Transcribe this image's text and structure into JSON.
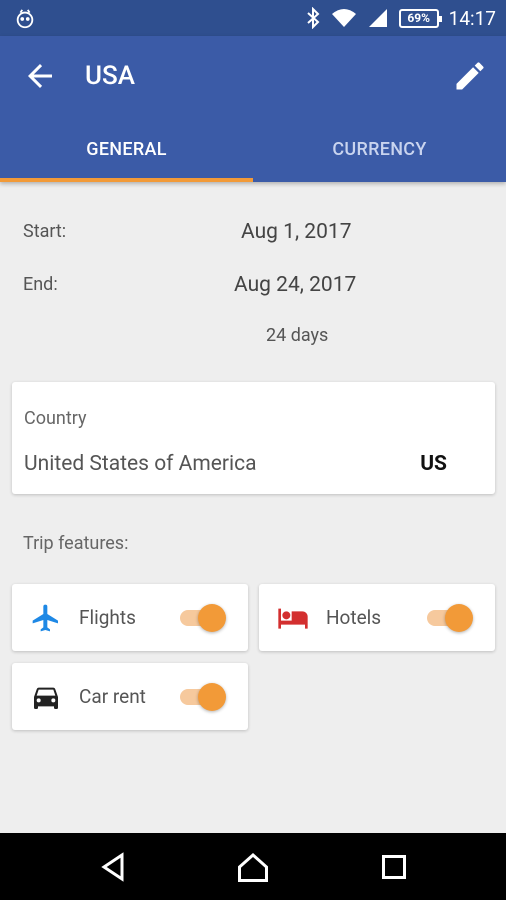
{
  "status_bar": {
    "time": "14:17",
    "battery": "69%",
    "icons": [
      "app-notification-icon",
      "bluetooth-icon",
      "wifi-icon",
      "signal-icon",
      "battery-icon"
    ]
  },
  "app_bar": {
    "title": "USA",
    "back_icon": "arrow-back-icon",
    "edit_icon": "pencil-icon",
    "color": "#3b5ba7"
  },
  "tabs": [
    {
      "label": "GENERAL",
      "active": true
    },
    {
      "label": "CURRENCY",
      "active": false
    }
  ],
  "dates": {
    "start_label": "Start:",
    "start_value": "Aug 1, 2017",
    "end_label": "End:",
    "end_value": "Aug 24, 2017",
    "duration": "24 days"
  },
  "country": {
    "label": "Country",
    "name": "United States of America",
    "code": "US"
  },
  "trip_features": {
    "label": "Trip features:",
    "items": [
      {
        "label": "Flights",
        "icon": "airplane-icon",
        "icon_color": "#1e88e5",
        "enabled": true
      },
      {
        "label": "Hotels",
        "icon": "hotel-bed-icon",
        "icon_color": "#d32f2f",
        "enabled": true
      },
      {
        "label": "Car rent",
        "icon": "car-icon",
        "icon_color": "#222222",
        "enabled": true
      }
    ]
  },
  "accent_color": "#f29a38",
  "nav_bar": {
    "icons": [
      "back-triangle-icon",
      "home-icon",
      "recents-square-icon"
    ]
  }
}
